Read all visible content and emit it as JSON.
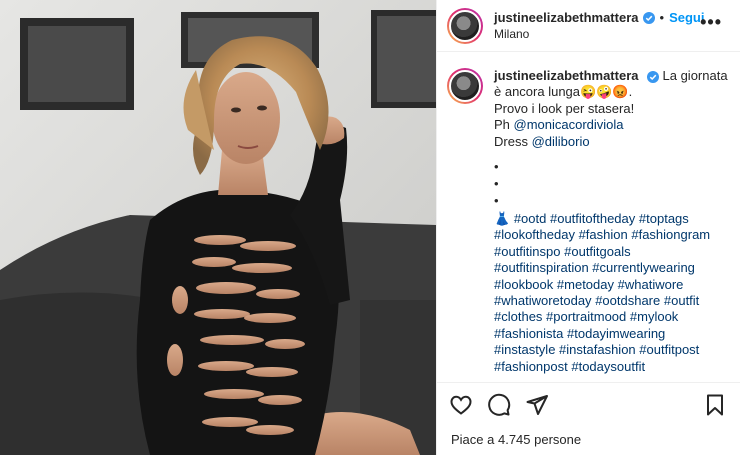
{
  "post": {
    "username": "justineelizabethmattera",
    "location": "Milano",
    "follow_label": "Segui",
    "more_label": "•••",
    "dot": "•"
  },
  "caption": {
    "username": "justineelizabethmattera",
    "line1": "La giornata è ancora lunga😜🤪😡.",
    "line2": "Provo i look per stasera!",
    "ph_prefix": "Ph ",
    "ph_mention": "@monicacordiviola",
    "dress_prefix": "Dress ",
    "dress_mention": "@diliborio",
    "bullets": [
      "•",
      "•",
      "•"
    ],
    "dress_emoji": "👗",
    "hashtags": [
      "#ootd",
      "#outfitoftheday",
      "#toptags",
      "#lookoftheday",
      "#fashion",
      "#fashiongram",
      "#outfitinspo",
      "#outfitgoals",
      "#outfitinspiration",
      "#currentlywearing",
      "#lookbook",
      "#metoday",
      "#whatiwore",
      "#whatiworetoday",
      "#ootdshare",
      "#outfit",
      "#clothes",
      "#portraitmood",
      "#mylook",
      "#fashionista",
      "#todayimwearing",
      "#instastyle",
      "#instafashion",
      "#outfitpost",
      "#fashionpost",
      "#todaysoutfit"
    ]
  },
  "likes": "Piace a 4.745 persone",
  "icons": {
    "like": "heart-icon",
    "comment": "comment-icon",
    "share": "paper-plane-icon",
    "save": "bookmark-icon",
    "verified": "verified-badge-icon"
  },
  "colors": {
    "link": "#00376b",
    "follow": "#0095f6",
    "verified": "#3897f0"
  }
}
